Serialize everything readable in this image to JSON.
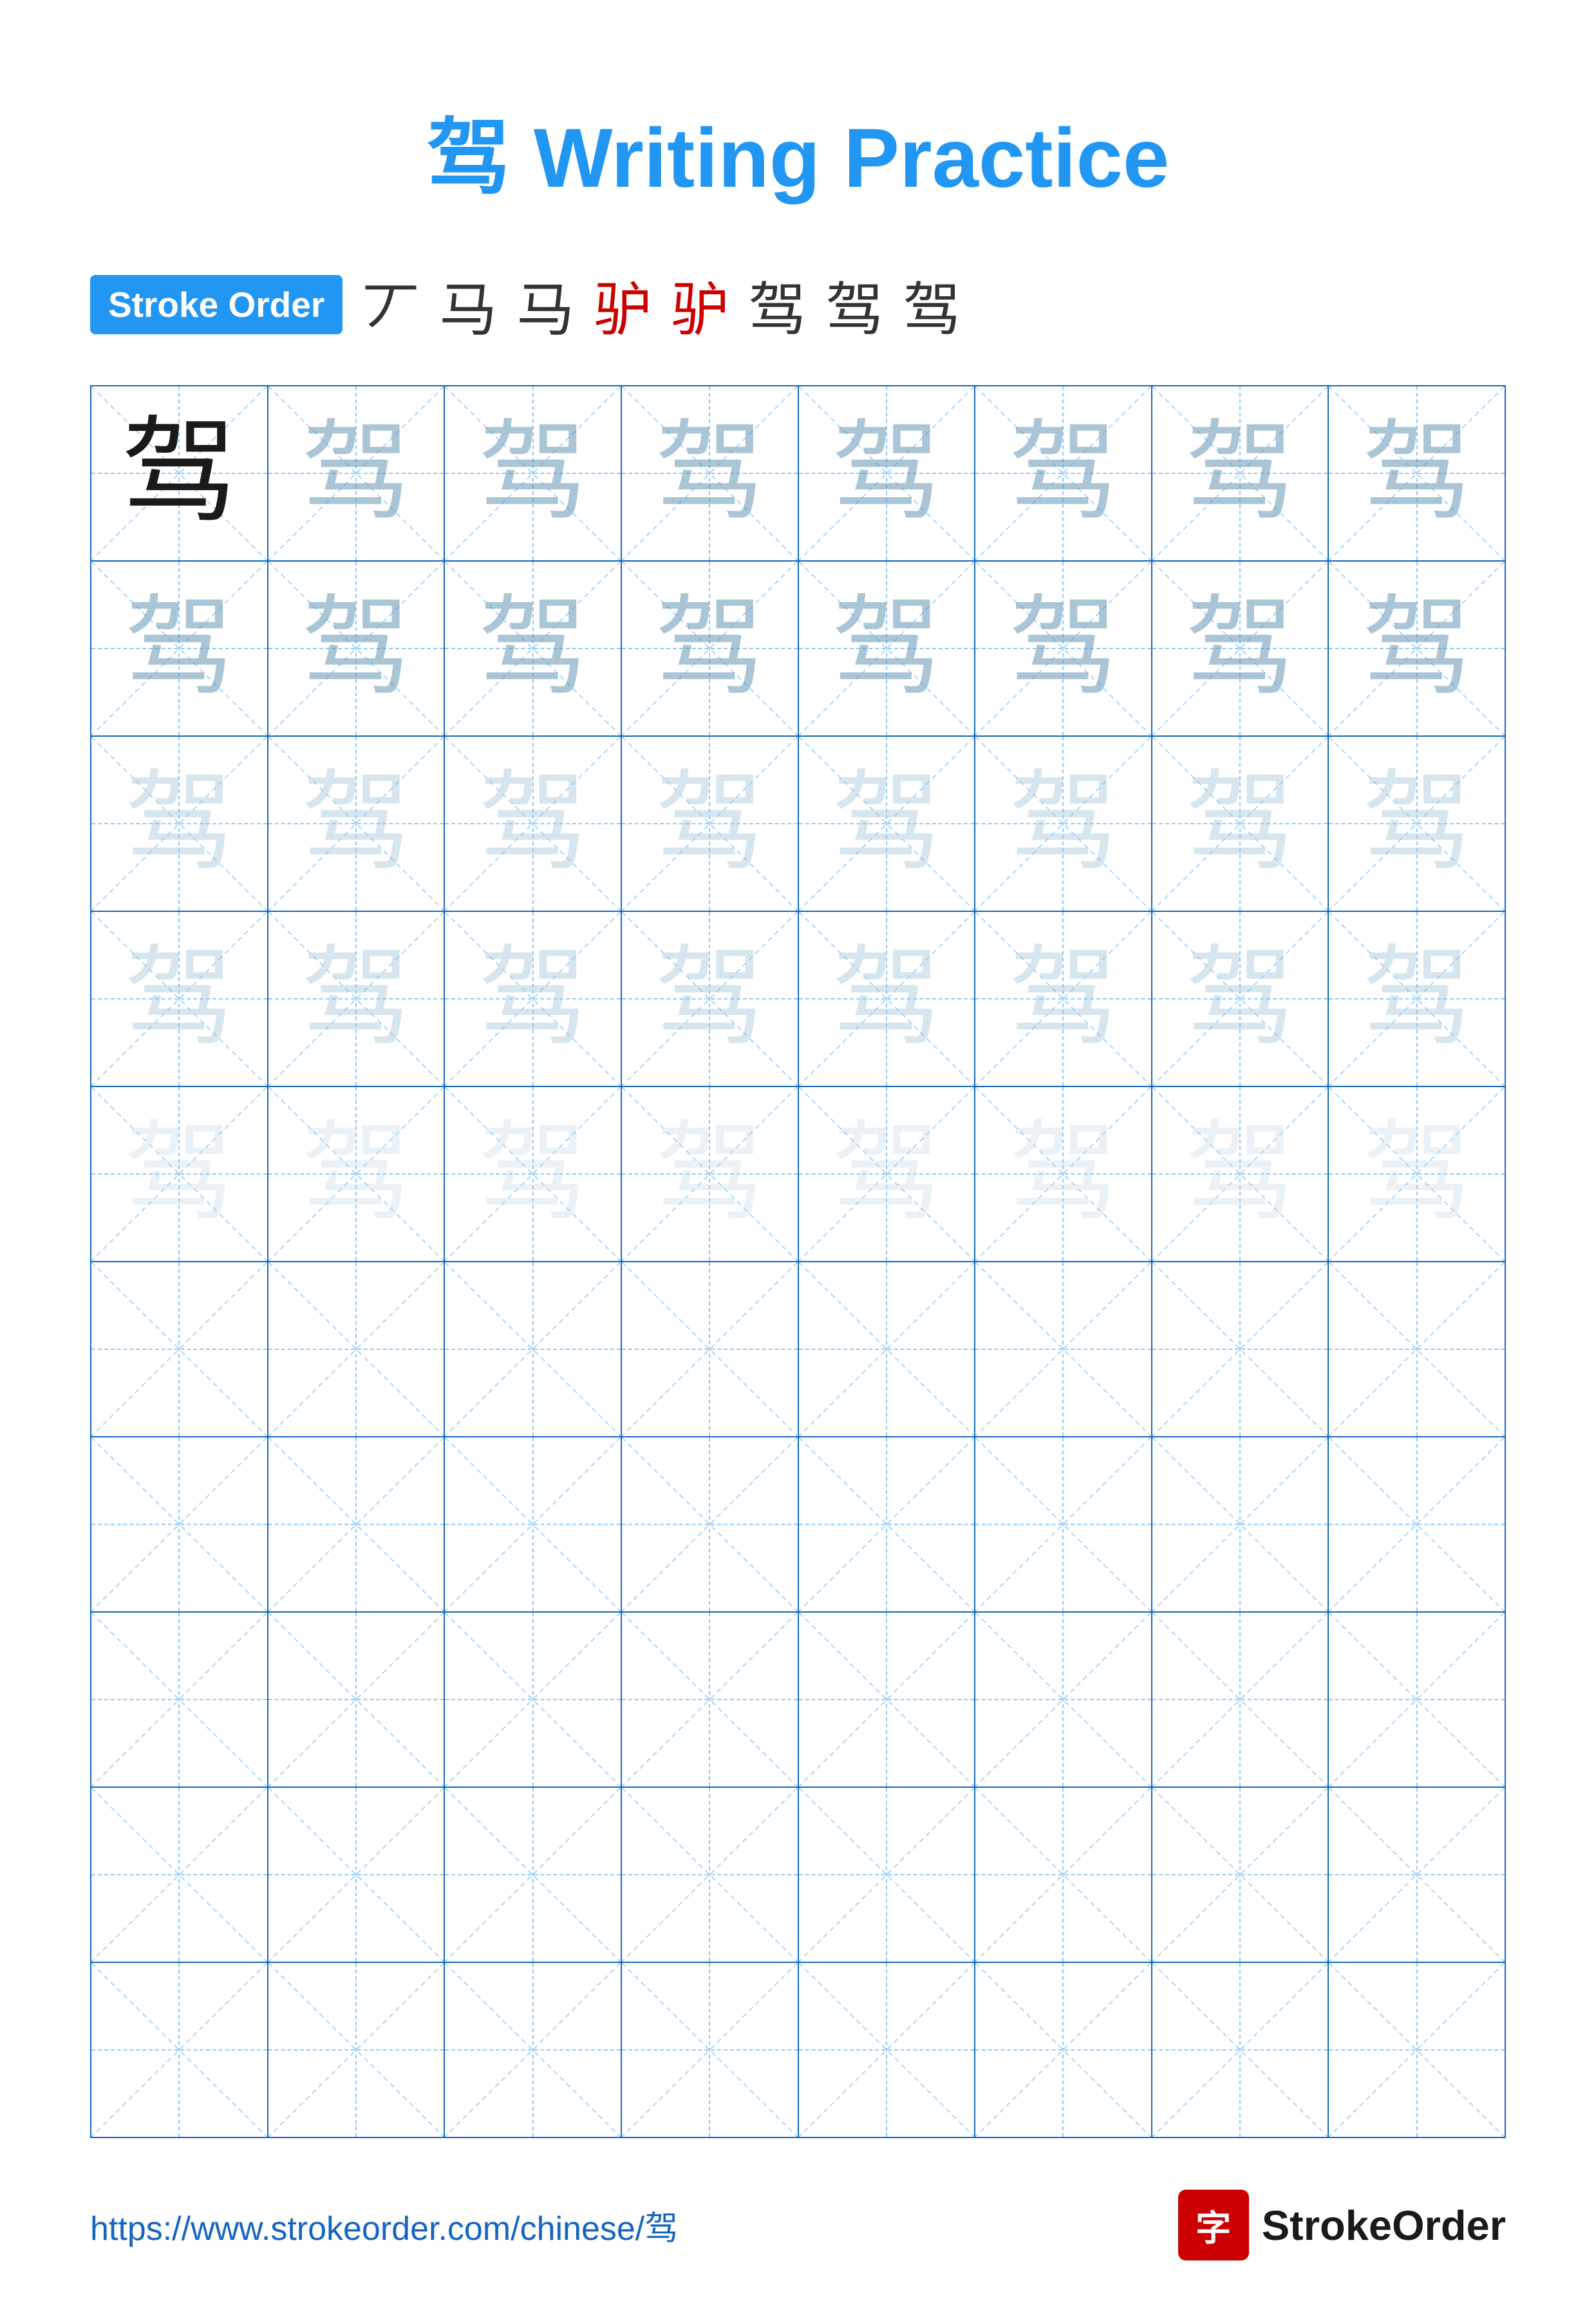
{
  "title": {
    "char": "驾",
    "text": "驾 Writing Practice"
  },
  "stroke_order": {
    "badge_label": "Stroke Order",
    "strokes": [
      "丆",
      "马",
      "马",
      "驴",
      "驴",
      "驾",
      "驾",
      "驾"
    ]
  },
  "grid": {
    "rows": 10,
    "cols": 8,
    "char": "驾",
    "row_styles": [
      "dark",
      "medium",
      "medium",
      "light",
      "faint",
      "empty",
      "empty",
      "empty",
      "empty",
      "empty"
    ]
  },
  "footer": {
    "url": "https://www.strokeorder.com/chinese/驾",
    "logo_char": "字",
    "logo_text": "StrokeOrder"
  }
}
